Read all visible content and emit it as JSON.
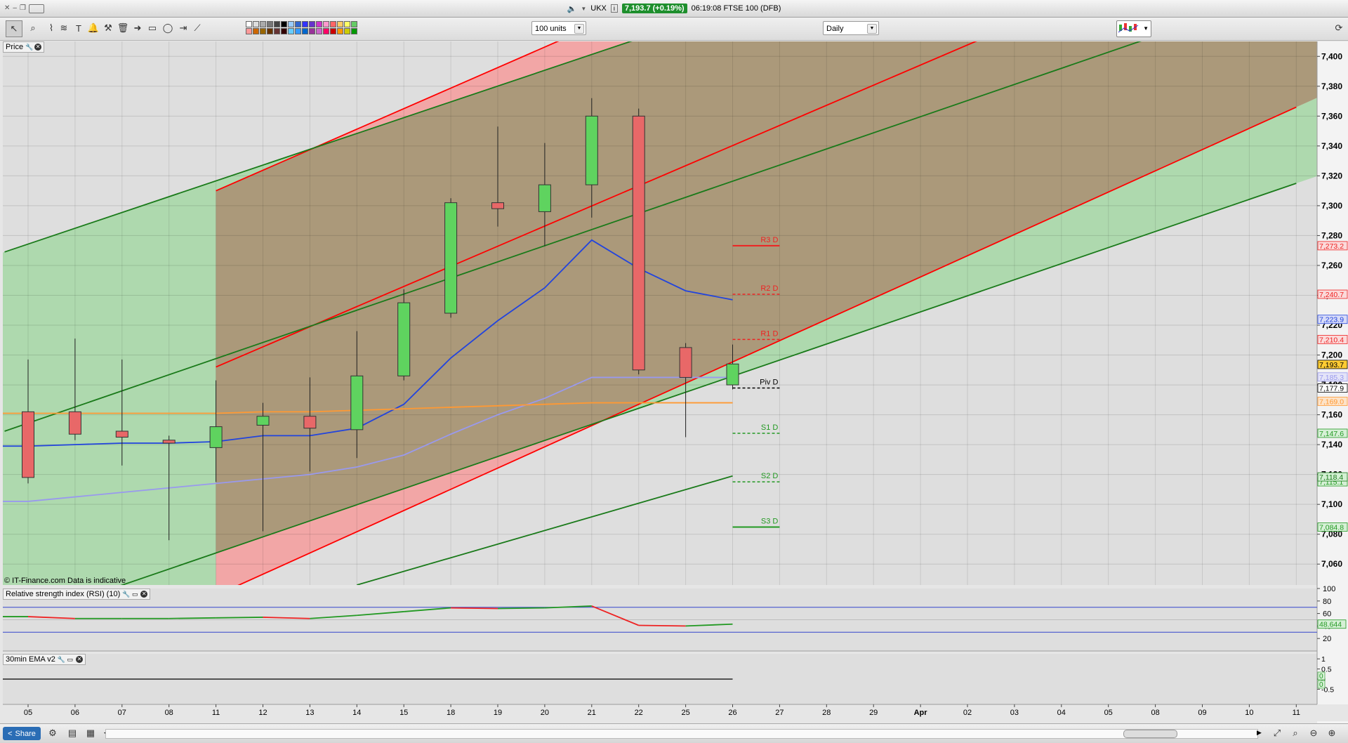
{
  "window": {
    "symbol": "UKX",
    "price_badge": "7,193.7 (+0.19%)",
    "title_rest": "06:19:08 FTSE 100 (DFB)"
  },
  "toolbar": {
    "units_select": "100 units",
    "interval_select": "Daily"
  },
  "price_panel": {
    "label": "Price",
    "copyright": "© IT-Finance.com  Data is indicative"
  },
  "rsi_panel": {
    "label": "Relative strength index (RSI) (10)"
  },
  "ema_panel": {
    "label": "30min EMA v2"
  },
  "bottombar": {
    "share_label": "Share"
  },
  "colors": {
    "bull": "#5fd35f",
    "bear": "#e86868",
    "channel_red": "#ff0000",
    "channel_green": "#1a7a1a",
    "ma_blue": "#2244dd",
    "ma_lavender": "#9999ee",
    "ma_orange": "#ff9933"
  },
  "chart_data": [
    {
      "type": "candlestick",
      "x": [
        "05",
        "06",
        "07",
        "08",
        "11",
        "12",
        "13",
        "14",
        "15",
        "18",
        "19",
        "20",
        "21",
        "22",
        "25",
        "26"
      ],
      "ohlc": [
        {
          "open": 7162,
          "high": 7197,
          "low": 7114,
          "close": 7118
        },
        {
          "open": 7162,
          "high": 7211,
          "low": 7143,
          "close": 7147
        },
        {
          "open": 7149,
          "high": 7197,
          "low": 7126,
          "close": 7145
        },
        {
          "open": 7143,
          "high": 7146,
          "low": 7076,
          "close": 7141
        },
        {
          "open": 7138,
          "high": 7183,
          "low": 7115,
          "close": 7152
        },
        {
          "open": 7153,
          "high": 7168,
          "low": 7082,
          "close": 7159
        },
        {
          "open": 7159,
          "high": 7185,
          "low": 7122,
          "close": 7151
        },
        {
          "open": 7150,
          "high": 7216,
          "low": 7131,
          "close": 7186
        },
        {
          "open": 7186,
          "high": 7244,
          "low": 7183,
          "close": 7235
        },
        {
          "open": 7228,
          "high": 7305,
          "low": 7225,
          "close": 7302
        },
        {
          "open": 7302,
          "high": 7353,
          "low": 7286,
          "close": 7298
        },
        {
          "open": 7296,
          "high": 7342,
          "low": 7273,
          "close": 7314
        },
        {
          "open": 7314,
          "high": 7372,
          "low": 7292,
          "close": 7360
        },
        {
          "open": 7360,
          "high": 7365,
          "low": 7187,
          "close": 7190
        },
        {
          "open": 7205,
          "high": 7208,
          "low": 7145,
          "close": 7185
        },
        {
          "open": 7180,
          "high": 7207,
          "low": 7177,
          "close": 7194
        }
      ],
      "x_axis_ticks": [
        "05",
        "06",
        "07",
        "08",
        "11",
        "12",
        "13",
        "14",
        "15",
        "18",
        "19",
        "20",
        "21",
        "22",
        "25",
        "26",
        "27",
        "28",
        "29",
        "Apr",
        "02",
        "03",
        "04",
        "05",
        "08",
        "09",
        "10",
        "11"
      ],
      "ylim": [
        7046,
        7410
      ],
      "y_ticks": [
        7060,
        7080,
        7100,
        7120,
        7140,
        7160,
        7180,
        7200,
        7220,
        7240,
        7260,
        7280,
        7300,
        7320,
        7340,
        7360,
        7380,
        7400
      ],
      "y_tick_labels": [
        "7,060",
        "7,080",
        "7,100",
        "7,120",
        "7,140",
        "7,160",
        "7,180",
        "7,200",
        "7,220",
        "7,240",
        "7,260",
        "7,280",
        "7,300",
        "7,320",
        "7,340",
        "7,360",
        "7,380",
        "7,400"
      ],
      "moving_averages": [
        {
          "color": "#2244dd",
          "values": [
            7139,
            7140,
            7141,
            7141,
            7142,
            7146,
            7146,
            7151,
            7167,
            7198,
            7223,
            7245,
            7277,
            7258,
            7243,
            7237
          ]
        },
        {
          "color": "#9999ee",
          "values": [
            7102,
            7105,
            7108,
            7111,
            7114,
            7117,
            7120,
            7125,
            7133,
            7147,
            7160,
            7171,
            7185,
            7185,
            7185,
            7185
          ]
        },
        {
          "color": "#ff9933",
          "values": [
            7161,
            7161,
            7161,
            7161,
            7161,
            7162,
            7162,
            7163,
            7164,
            7165,
            7166,
            7167,
            7168,
            7168,
            7168,
            7168
          ]
        }
      ],
      "pivots": [
        {
          "label": "R3 D",
          "value": 7273.2,
          "value_label": "7,273.2",
          "color": "#ee2222",
          "dashed": false
        },
        {
          "label": "R2 D",
          "value": 7240.7,
          "value_label": "7,240.7",
          "color": "#ee2222",
          "dashed": true
        },
        {
          "label": "R1 D",
          "value": 7210.4,
          "value_label": "7,210.4",
          "color": "#ee2222",
          "dashed": true
        },
        {
          "label": "Piv D",
          "value": 7177.9,
          "value_label": "7,177.9",
          "color": "#000000",
          "dashed": true
        },
        {
          "label": "S1 D",
          "value": 7147.6,
          "value_label": "7,147.6",
          "color": "#229922",
          "dashed": true
        },
        {
          "label": "S2 D",
          "value": 7115.1,
          "value_label": "7,115.1",
          "color": "#229922",
          "dashed": true
        },
        {
          "label": "S3 D",
          "value": 7084.8,
          "value_label": "7,084.8",
          "color": "#229922",
          "dashed": false
        }
      ],
      "axis_badges": [
        {
          "value": 7223.9,
          "text": "7,223.9",
          "bg": "#d8dcf8",
          "fg": "#2244dd"
        },
        {
          "value": 7193.7,
          "text": "7,193.7",
          "bg": "#ffcc33",
          "fg": "#000000"
        },
        {
          "value": 7185.3,
          "text": "7,185.3",
          "bg": "#e4e4f8",
          "fg": "#9999ee"
        },
        {
          "value": 7169.0,
          "text": "7,169.0",
          "bg": "#fde3c8",
          "fg": "#ff9933"
        },
        {
          "value": 7118.4,
          "text": "7,118.4",
          "bg": "#d2f0d2",
          "fg": "#1a7a1a"
        }
      ],
      "channel_lines": [
        {
          "color": "#ff0000",
          "p1": {
            "i": 4,
            "v": 7310
          },
          "p2": {
            "i": 12,
            "v": 7420
          }
        },
        {
          "color": "#ff0000",
          "p1": {
            "i": 4,
            "v": 7192
          },
          "p2": {
            "i": 27,
            "v": 7502
          }
        },
        {
          "color": "#ff0000",
          "p1": {
            "i": 4,
            "v": 7039
          },
          "p2": {
            "i": 27,
            "v": 7366
          }
        },
        {
          "color": "#1a7a1a",
          "p1": {
            "i": -0.5,
            "v": 7269
          },
          "p2": {
            "i": 27,
            "v": 7560
          }
        },
        {
          "color": "#1a7a1a",
          "p1": {
            "i": -0.5,
            "v": 7149
          },
          "p2": {
            "i": 27,
            "v": 7446
          }
        },
        {
          "color": "#1a7a1a",
          "p1": {
            "i": -0.5,
            "v": 7019
          },
          "p2": {
            "i": 27,
            "v": 7315
          }
        },
        {
          "color": "#1a7a1a",
          "p1": {
            "i": 7,
            "v": 7046
          },
          "p2": {
            "i": 15,
            "v": 7119
          }
        }
      ]
    },
    {
      "type": "line",
      "name": "Relative strength index (RSI) (10)",
      "x": [
        "05",
        "06",
        "07",
        "08",
        "11",
        "12",
        "13",
        "14",
        "15",
        "18",
        "19",
        "20",
        "21",
        "22",
        "25",
        "26"
      ],
      "values": [
        55,
        52,
        52,
        52,
        53,
        54,
        52,
        57,
        63,
        69,
        68,
        69,
        72,
        41,
        40,
        43
      ],
      "ylim": [
        0,
        100
      ],
      "y_ticks": [
        20,
        40,
        60,
        80,
        100
      ],
      "y_tick_labels": [
        "20",
        "40",
        "60",
        "80",
        "100"
      ],
      "levels": [
        70,
        30
      ],
      "last_value_label": "48.644"
    },
    {
      "type": "line",
      "name": "30min EMA v2",
      "y_tick_labels": [
        "1",
        "0.5",
        "0",
        "-0.5"
      ],
      "zero_badges": [
        "0",
        "0"
      ]
    }
  ]
}
